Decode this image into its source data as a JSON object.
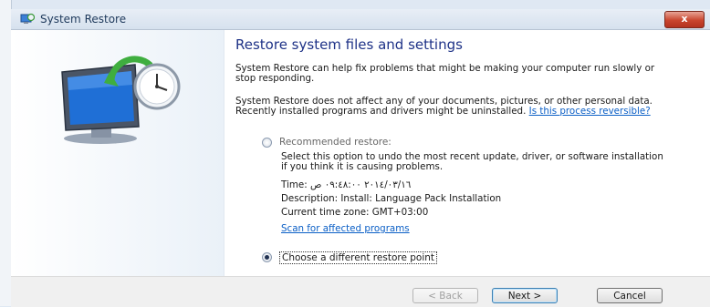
{
  "window": {
    "title": "System Restore",
    "close_label": "x"
  },
  "heading": "Restore system files and settings",
  "intro": {
    "p1": "System Restore can help fix problems that might be making your computer run slowly or stop responding.",
    "p2": "System Restore does not affect any of your documents, pictures, or other personal data. Recently installed programs and drivers might be uninstalled.",
    "p2_link": "Is this process reversible?"
  },
  "recommended": {
    "label": "Recommended restore:",
    "selected": false,
    "description": "Select this option to undo the most recent update, driver, or software installation if you think it is causing problems.",
    "time": "Time: ٢٠١٤/٠٣/١٦ ٠٩:٤٨:٠٠ ص",
    "desc": "Description: Install: Language Pack Installation",
    "timezone": "Current time zone: GMT+03:00",
    "scan_link": "Scan for affected programs"
  },
  "choose": {
    "label": "Choose a different restore point",
    "selected": true
  },
  "buttons": {
    "back": "< Back",
    "next": "Next >",
    "cancel": "Cancel"
  },
  "icons": {
    "title": "system-restore-icon",
    "art": "system-restore-monitor-clock-icon"
  }
}
